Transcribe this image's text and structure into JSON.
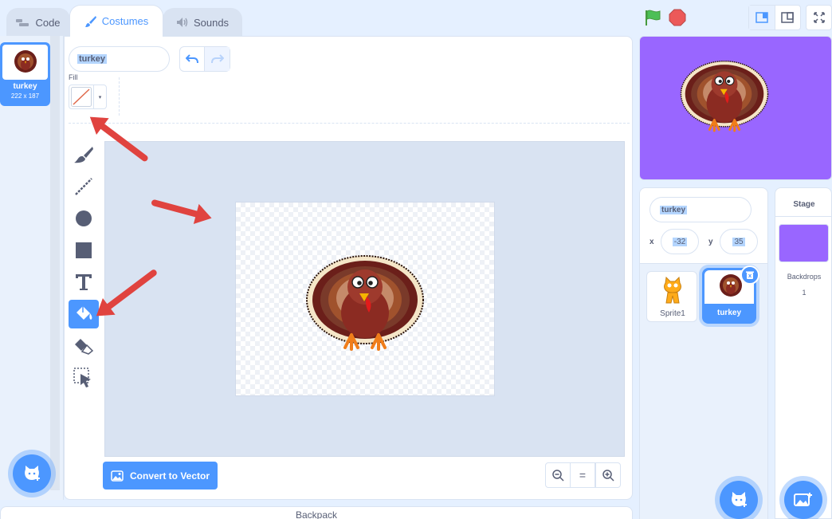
{
  "tabs": [
    {
      "label": "Code",
      "icon": "code-icon"
    },
    {
      "label": "Costumes",
      "icon": "paintbrush-icon"
    },
    {
      "label": "Sounds",
      "icon": "speaker-icon"
    }
  ],
  "costume_list": {
    "item": {
      "number": "1",
      "name": "turkey",
      "size": "222 x 187"
    }
  },
  "editor": {
    "costume_name": "turkey",
    "fill_label": "Fill",
    "convert_button": "Convert to Vector",
    "zoom": {
      "zoom_out": "−",
      "reset": "=",
      "zoom_in": "+"
    }
  },
  "tools": [
    "brush",
    "line",
    "circle",
    "rectangle",
    "text",
    "fill",
    "eraser",
    "select"
  ],
  "active_tool": "fill",
  "sprite_info": {
    "name": "turkey",
    "x_label": "x",
    "x_value": "-32",
    "y_label": "y",
    "y_value": "35"
  },
  "sprites": [
    {
      "name": "Sprite1"
    },
    {
      "name": "turkey"
    }
  ],
  "stage_panel": {
    "title": "Stage",
    "backdrops_label": "Backdrops",
    "backdrops_count": "1"
  },
  "backpack_label": "Backpack",
  "colors": {
    "accent": "#4c97ff",
    "stage_bg": "#9966ff",
    "arrow": "#e0433f"
  }
}
